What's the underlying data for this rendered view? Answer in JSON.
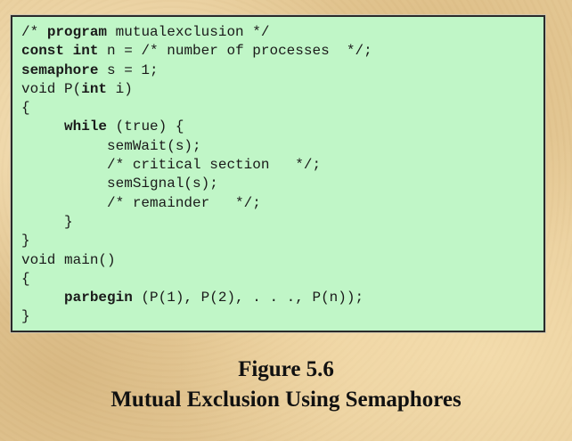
{
  "code_lines": [
    [
      {
        "t": "/* "
      },
      {
        "t": "program",
        "b": true
      },
      {
        "t": " mutualexclusion */"
      }
    ],
    [
      {
        "t": "const",
        "b": true
      },
      {
        "t": " "
      },
      {
        "t": "int",
        "b": true
      },
      {
        "t": " n = /* number of processes  */;"
      }
    ],
    [
      {
        "t": "semaphore",
        "b": true
      },
      {
        "t": " s = 1;"
      }
    ],
    [
      {
        "t": "void P("
      },
      {
        "t": "int",
        "b": true
      },
      {
        "t": " i)"
      }
    ],
    [
      {
        "t": "{"
      }
    ],
    [
      {
        "t": "     "
      },
      {
        "t": "while",
        "b": true
      },
      {
        "t": " (true) {"
      }
    ],
    [
      {
        "t": "          semWait(s);"
      }
    ],
    [
      {
        "t": "          /* critical section   */;"
      }
    ],
    [
      {
        "t": "          semSignal(s);"
      }
    ],
    [
      {
        "t": "          /* remainder   */;"
      }
    ],
    [
      {
        "t": "     }"
      }
    ],
    [
      {
        "t": "}"
      }
    ],
    [
      {
        "t": "void main()"
      }
    ],
    [
      {
        "t": "{"
      }
    ],
    [
      {
        "t": "     "
      },
      {
        "t": "parbegin",
        "b": true
      },
      {
        "t": " ("
      },
      {
        "t": "P(1), P(2), . . ., P(n));"
      }
    ],
    [
      {
        "t": "}"
      }
    ]
  ],
  "caption": {
    "figure_label": "Figure 5.6",
    "title": "Mutual Exclusion Using Semaphores"
  }
}
